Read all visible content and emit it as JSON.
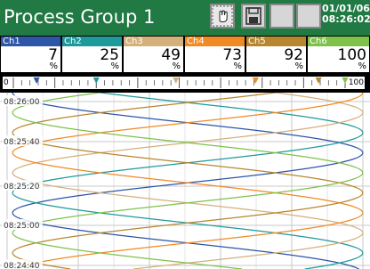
{
  "header": {
    "title": "Process Group 1",
    "date": "01/01/06",
    "time": "08:26:02",
    "buttons": {
      "hand": "hand-cursor-icon",
      "save": "floppy-disk-icon"
    }
  },
  "channels": [
    {
      "name": "Ch1",
      "value": "7",
      "unit": "%",
      "color": "#2d55a8"
    },
    {
      "name": "Ch2",
      "value": "25",
      "unit": "%",
      "color": "#1f9a9a"
    },
    {
      "name": "Ch3",
      "value": "49",
      "unit": "%",
      "color": "#d4b07a"
    },
    {
      "name": "Ch4",
      "value": "73",
      "unit": "%",
      "color": "#f08a24"
    },
    {
      "name": "Ch5",
      "value": "92",
      "unit": "%",
      "color": "#b8862e"
    },
    {
      "name": "Ch6",
      "value": "100",
      "unit": "%",
      "color": "#7ec24a"
    }
  ],
  "scale": {
    "min": "0",
    "max": "100"
  },
  "trend": {
    "time_labels": [
      "08:26:00",
      "08:25:40",
      "08:25:20",
      "08:25:00",
      "08:24:40"
    ],
    "background": "#ffffff",
    "grid_color": "#c8c8c8"
  }
}
